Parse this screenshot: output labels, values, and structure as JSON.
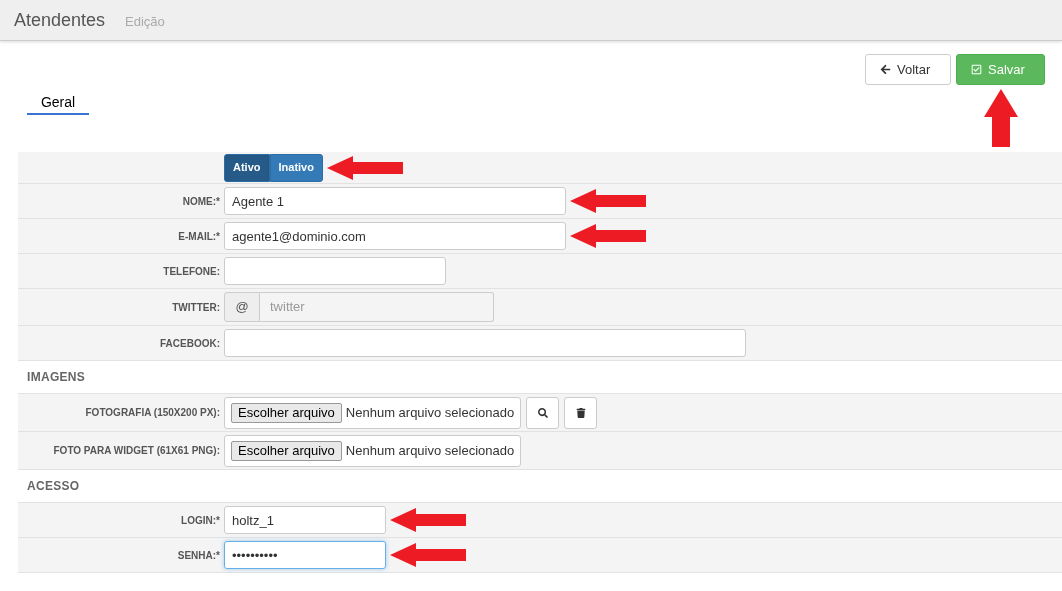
{
  "header": {
    "title": "Atendentes",
    "subtitle": "Edição"
  },
  "actions": [
    {
      "kind": "back",
      "label": "Voltar",
      "annotated": false
    },
    {
      "kind": "save",
      "label": "Salvar",
      "annotated": true
    }
  ],
  "tabs": [
    {
      "label": "Geral",
      "selected": true
    }
  ],
  "sections": [
    {
      "rows": [
        {
          "kind": "toggle",
          "options": [
            {
              "label": "Ativo",
              "selected": true
            },
            {
              "label": "Inativo",
              "selected": false
            }
          ],
          "annotated": true
        },
        {
          "kind": "text",
          "label": "NOME:*",
          "value": "Agente 1",
          "annotated": true,
          "focused": false
        },
        {
          "kind": "text",
          "label": "E-MAIL:*",
          "value": "agente1@dominio.com",
          "annotated": true,
          "focused": false
        },
        {
          "kind": "text",
          "label": "TELEFONE:",
          "annotated": false,
          "focused": false
        },
        {
          "kind": "addon",
          "label": "TWITTER:",
          "addon": "@",
          "placeholder": "twitter",
          "annotated": false
        },
        {
          "kind": "text",
          "label": "FACEBOOK:",
          "annotated": false,
          "focused": false
        }
      ]
    },
    {
      "title": "IMAGENS",
      "rows": [
        {
          "kind": "file",
          "label": "FOTOGRAFIA (150X200 PX):",
          "button": "Escolher arquivo",
          "status": "Nenhum arquivo selecionado",
          "tools": [
            {
              "kind": "search"
            },
            {
              "kind": "delete"
            }
          ],
          "annotated": false
        },
        {
          "kind": "file",
          "label": "FOTO PARA WIDGET (61X61 PNG):",
          "button": "Escolher arquivo",
          "status": "Nenhum arquivo selecionado",
          "annotated": false
        }
      ]
    },
    {
      "title": "ACESSO",
      "rows": [
        {
          "kind": "text",
          "label": "LOGIN:*",
          "value": "holtz_1",
          "annotated": true,
          "focused": false
        },
        {
          "kind": "text",
          "label": "SENHA:*",
          "value": "••••••••••",
          "annotated": true,
          "focused": true
        }
      ]
    }
  ]
}
